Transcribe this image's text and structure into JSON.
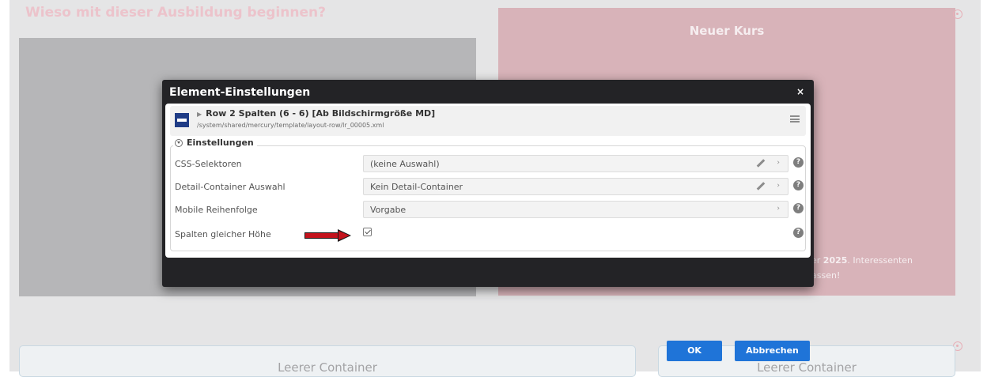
{
  "background": {
    "heading": "Wieso mit dieser Ausbildung beginnen?",
    "pink_panel_title": "Neuer Kurs",
    "pink_panel_text_line1_a": "er ",
    "pink_panel_text_line1_b": "2025",
    "pink_panel_text_line1_c": ". Interessenten",
    "pink_panel_text_line2": "assen!",
    "empty_container_label": "Leerer Container"
  },
  "dialog": {
    "title": "Element-Einstellungen",
    "close_label": "×",
    "element_title": "Row 2 Spalten (6 - 6) [Ab Bildschirmgröße MD]",
    "element_path": "/system/shared/mercury/template/layout-row/lr_00005.xml",
    "section_label": "Einstellungen",
    "rows": [
      {
        "label": "CSS-Selektoren",
        "value": "(keine Auswahl)"
      },
      {
        "label": "Detail-Container Auswahl",
        "value": "Kein Detail-Container"
      },
      {
        "label": "Mobile Reihenfolge",
        "value": "Vorgabe"
      },
      {
        "label": "Spalten gleicher Höhe",
        "checked": true
      }
    ],
    "help_glyph": "?",
    "chevron_glyph": "›",
    "ok_label": "OK",
    "cancel_label": "Abbrechen"
  },
  "colors": {
    "dialog_bg": "#232326",
    "button_blue": "#1f74d8",
    "arrow_red": "#c4121c",
    "pink_panel": "#d8b3b9"
  }
}
